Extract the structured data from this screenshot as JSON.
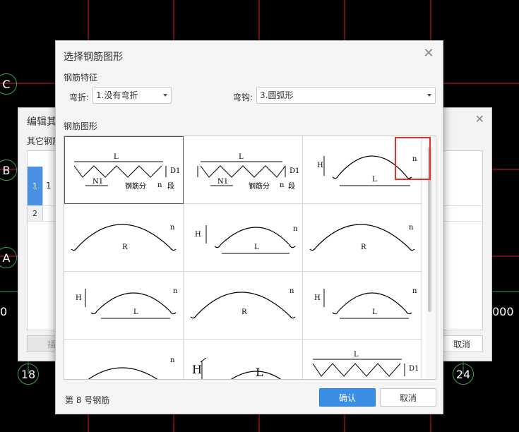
{
  "cad": {
    "axes_left": [
      "C",
      "B",
      "A"
    ],
    "axes_bottom": [
      "18",
      "24"
    ],
    "left_number": "0",
    "right_number": "000"
  },
  "back_dialog": {
    "title": "编辑其",
    "subtitle": "其它钢筋",
    "rows": [
      {
        "index": "1",
        "value": "1"
      },
      {
        "index": "2",
        "value": ""
      }
    ],
    "insert_label": "插",
    "cancel_label": "取消"
  },
  "dialog": {
    "title": "选择钢筋图形",
    "features_label": "钢筋特征",
    "bend_label": "弯折:",
    "bend_value": "1.没有弯折",
    "hook_label": "弯钩:",
    "hook_value": "3.圆弧形",
    "shapes_label": "钢筋图形",
    "status": "第 8 号钢筋",
    "ok_label": "确认",
    "cancel_label": "取消"
  },
  "shape_labels": {
    "L": "L",
    "D1": "D1",
    "N1": "N1",
    "n": "n",
    "H": "H",
    "R": "R",
    "segment_text": "钢筋分",
    "segment_tail": "段"
  }
}
